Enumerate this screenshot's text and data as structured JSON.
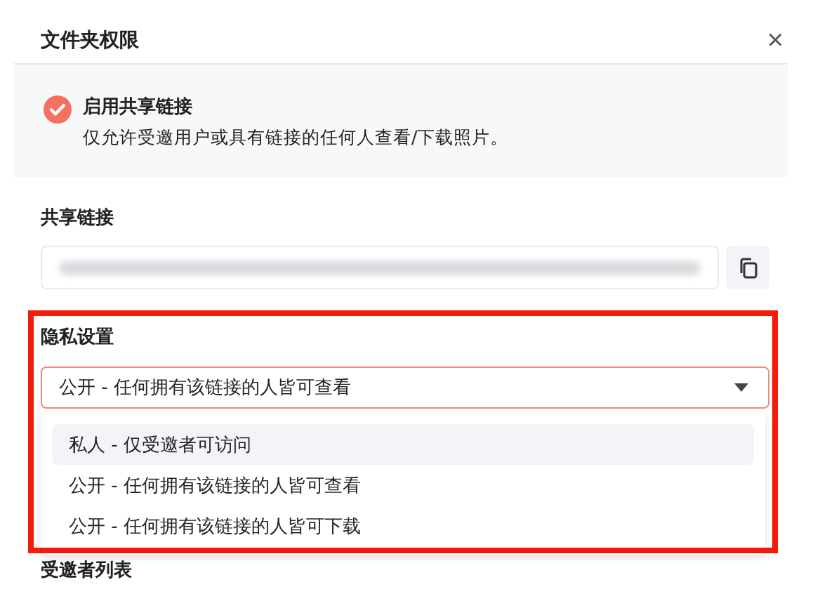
{
  "dialog": {
    "title": "文件夹权限",
    "close": "×"
  },
  "share_toggle": {
    "checked": true,
    "title": "启用共享链接",
    "description": "仅允许受邀用户或具有链接的任何人查看/下载照片。"
  },
  "share_link": {
    "label": "共享链接"
  },
  "privacy": {
    "label": "隐私设置",
    "value": "公开 - 任何拥有该链接的人皆可查看",
    "options": [
      {
        "label": "私人 - 仅受邀者可访问",
        "highlighted": true
      },
      {
        "label": "公开 - 任何拥有该链接的人皆可查看",
        "highlighted": false
      },
      {
        "label": "公开 - 任何拥有该链接的人皆可下载",
        "highlighted": false
      }
    ]
  },
  "invitees": {
    "label": "受邀者列表"
  }
}
